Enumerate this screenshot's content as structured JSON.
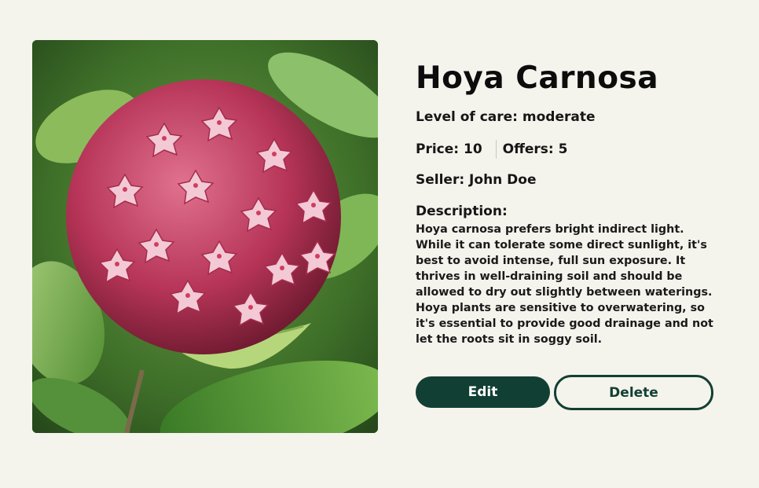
{
  "plant": {
    "name": "Hoya Carnosa",
    "care": "Level of care: moderate",
    "price": "Price: 10",
    "offers": "Offers: 5",
    "seller": "Seller: John Doe",
    "description_heading": "Description:",
    "description": "Hoya carnosa prefers bright indirect light. While it can tolerate some direct sunlight, it's best to avoid intense, full sun exposure. It thrives in well-draining soil and should be allowed to dry out slightly between waterings. Hoya plants are sensitive to overwatering, so it's essential to provide good drainage and not let the roots sit in soggy soil."
  },
  "actions": {
    "edit_label": "Edit",
    "delete_label": "Delete"
  },
  "colors": {
    "background": "#f4f3ec",
    "accent": "#123f33",
    "flower": "#c23a64",
    "leaf": "#5f9a3d"
  }
}
